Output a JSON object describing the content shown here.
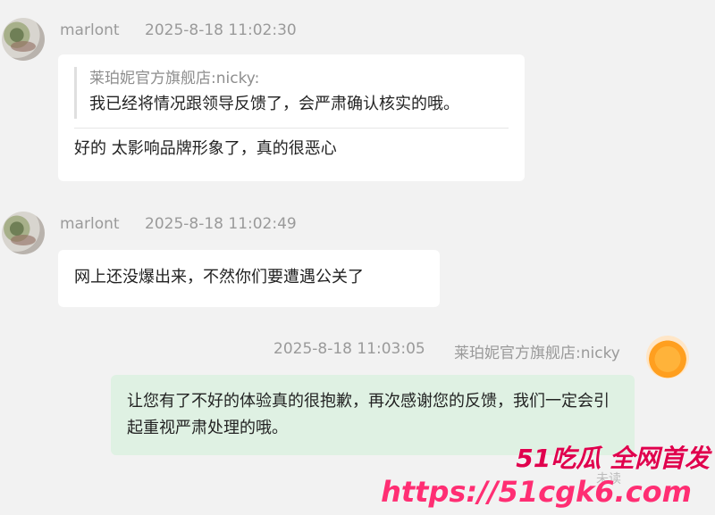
{
  "messages": [
    {
      "sender": "marlont",
      "timestamp": "2025-8-18 11:02:30",
      "quote": {
        "author": "莱珀妮官方旗舰店:nicky:",
        "text": "我已经将情况跟领导反馈了，会严肃确认核实的哦。"
      },
      "text": "好的 太影响品牌形象了，真的很恶心"
    },
    {
      "sender": "marlont",
      "timestamp": "2025-8-18 11:02:49",
      "text": "网上还没爆出来，不然你们要遭遇公关了"
    },
    {
      "sender": "莱珀妮官方旗舰店:nicky",
      "timestamp": "2025-8-18 11:03:05",
      "text": "让您有了不好的体验真的很抱歉，再次感谢您的反馈，我们一定会引起重视严肃处理的哦。",
      "status": "未读"
    }
  ],
  "watermark": {
    "title": "51吃瓜 全网首发",
    "url": "https://51cgk6.com"
  }
}
